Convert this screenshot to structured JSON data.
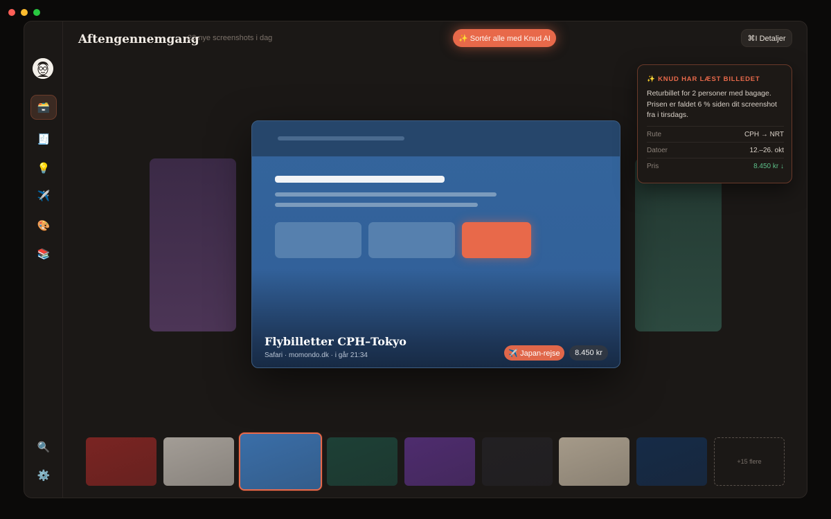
{
  "window": {
    "traffic_lights": [
      "close",
      "minimize",
      "zoom"
    ]
  },
  "header": {
    "title": "Aftengennemgang",
    "subtitle": "23 nye screenshots i dag",
    "sort_button": "✨ Sortér alle med Knud AI",
    "details_button": "⌘I Detaljer"
  },
  "sidebar": {
    "avatar": "avatar-face",
    "nav_items": [
      {
        "icon": "🗃️",
        "name": "inbox-box-icon",
        "active": true
      },
      {
        "icon": "🧾",
        "name": "receipt-icon"
      },
      {
        "icon": "💡",
        "name": "lightbulb-icon"
      },
      {
        "icon": "✈️",
        "name": "airplane-icon"
      },
      {
        "icon": "🎨",
        "name": "palette-icon"
      },
      {
        "icon": "📚",
        "name": "books-icon"
      }
    ],
    "bottom_items": [
      {
        "icon": "🔍",
        "name": "search-icon"
      },
      {
        "icon": "⚙️",
        "name": "gear-icon"
      }
    ]
  },
  "main_card": {
    "title": "Flybilletter CPH–Tokyo",
    "meta": "Safari · momondo.dk · i går 21:34",
    "tag": "✈️ Japan-rejse",
    "price": "8.450 kr"
  },
  "ai_panel": {
    "heading": "✨ KNUD HAR LÆST BILLEDET",
    "body": "Returbillet for 2 personer med bagage. Prisen er faldet 6 % siden dit screenshot fra i tirsdags.",
    "rows": [
      {
        "key": "Rute",
        "value": "CPH → NRT"
      },
      {
        "key": "Datoer",
        "value": "12.–26. okt"
      },
      {
        "key": "Pris",
        "value": "8.450 kr ↓"
      }
    ]
  },
  "colors": {
    "accent": "#e8694a",
    "price_down": "#5cc08a",
    "thumbs": [
      "#7a2422",
      "#a39d96",
      "#3a6ea8",
      "#1d4036",
      "#4e2c6e",
      "#222023",
      "#a59a89",
      "#162b47"
    ]
  },
  "thumbnail_strip": {
    "more_label": "+15 flere",
    "selected_index": 2
  }
}
